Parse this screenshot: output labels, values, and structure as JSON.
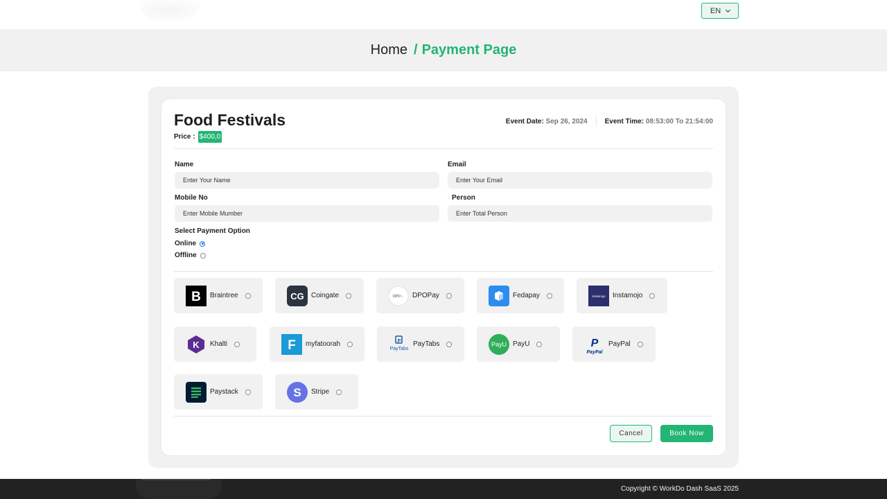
{
  "header": {
    "language": "EN"
  },
  "breadcrumb": {
    "home": "Home",
    "separator": "/",
    "current": "Payment Page"
  },
  "event": {
    "title": "Food Festivals",
    "price_label": "Price :",
    "price_value": "$400,0",
    "date_label": "Event Date:",
    "date_value": "Sep 26, 2024",
    "time_label": "Event Time:",
    "time_value": "08:53:00 To 21:54:00"
  },
  "form": {
    "name_label": "Name",
    "name_placeholder": "Enter Your Name",
    "email_label": "Email",
    "email_placeholder": "Enter Your Email",
    "mobile_label": "Mobile No",
    "mobile_placeholder": "Enter Mobile Mumber",
    "person_label": "Person",
    "person_placeholder": "Enter Total Person",
    "payment_option_label": "Select Payment Option",
    "online_label": "Online",
    "offline_label": "Offline",
    "selected_option": "Online"
  },
  "gateways": [
    {
      "name": "Braintree",
      "icon": "braintree-icon",
      "color": "#000000"
    },
    {
      "name": "Coingate",
      "icon": "coingate-icon",
      "color": "#2b3540"
    },
    {
      "name": "DPOPay",
      "icon": "dpopay-icon",
      "color": "#ffffff"
    },
    {
      "name": "Fedapay",
      "icon": "fedapay-icon",
      "color": "#2d8cf0"
    },
    {
      "name": "Instamojo",
      "icon": "instamojo-icon",
      "color": "#2b2f6b"
    },
    {
      "name": "Khalti",
      "icon": "khalti-icon",
      "color": "#5c2d91"
    },
    {
      "name": "myfatoorah",
      "icon": "myfatoorah-icon",
      "color": "#1a9ad6"
    },
    {
      "name": "PayTabs",
      "icon": "paytabs-icon",
      "color": "#1a5aa6"
    },
    {
      "name": "PayU",
      "icon": "payu-icon",
      "color": "#2fae5a"
    },
    {
      "name": "PayPal",
      "icon": "paypal-icon",
      "color": "#003087"
    },
    {
      "name": "Paystack",
      "icon": "paystack-icon",
      "color": "#011b33"
    },
    {
      "name": "Stripe",
      "icon": "stripe-icon",
      "color": "#6772e5"
    }
  ],
  "actions": {
    "cancel": "Cancel",
    "book": "Book Now"
  },
  "footer": {
    "copyright": "Copyright © WorkDo Dash SaaS 2025"
  },
  "colors": {
    "accent": "#22b573",
    "band": "#f1f1f1",
    "footer": "#222222"
  }
}
